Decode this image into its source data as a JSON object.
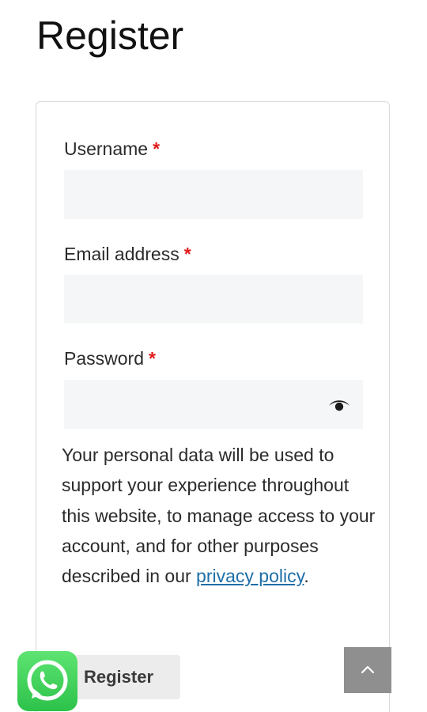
{
  "page": {
    "title": "Register"
  },
  "form": {
    "username_label": "Username",
    "email_label": "Email address",
    "password_label": "Password",
    "required_marker": "*",
    "username_value": "",
    "email_value": "",
    "password_value": ""
  },
  "privacy": {
    "text_before": "Your personal data will be used to support your experience throughout this website, to manage access to your account, and for other purposes described in our ",
    "link_text": "privacy policy",
    "text_after": "."
  },
  "actions": {
    "register_label": "Register"
  },
  "icons": {
    "password_toggle": "eye-icon",
    "whatsapp": "whatsapp-icon",
    "scroll_top": "chevron-up-icon"
  },
  "colors": {
    "required": "#e01b1b",
    "link": "#1e6fa8",
    "whatsapp": "#2cc24a",
    "scroll_top_bg": "#8f8f8f"
  }
}
